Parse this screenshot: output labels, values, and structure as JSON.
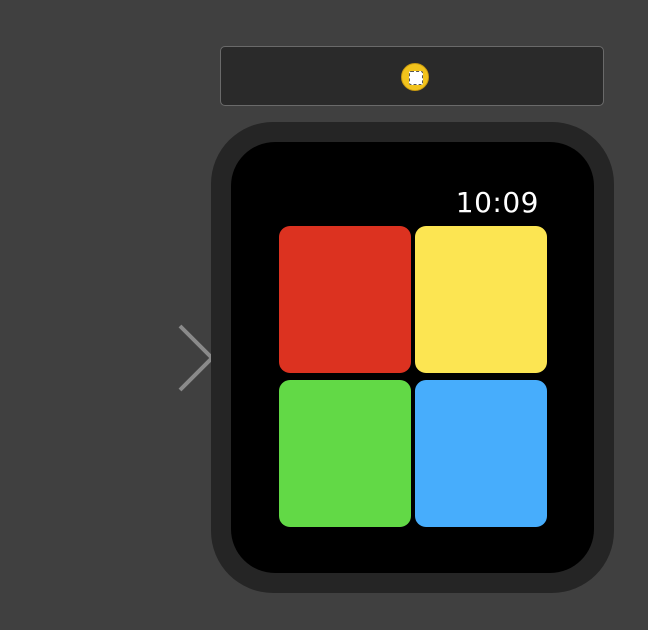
{
  "watch": {
    "time": "10:09"
  },
  "dock": {
    "icon": "interface-controller-icon",
    "icon_color": "#f2c31c"
  },
  "entry_arrow": {
    "icon": "entry-point-arrow-icon"
  },
  "tiles": [
    {
      "name": "red",
      "color": "#dc3220"
    },
    {
      "name": "yellow",
      "color": "#fce552"
    },
    {
      "name": "green",
      "color": "#62d946"
    },
    {
      "name": "blue",
      "color": "#47adfc"
    }
  ]
}
